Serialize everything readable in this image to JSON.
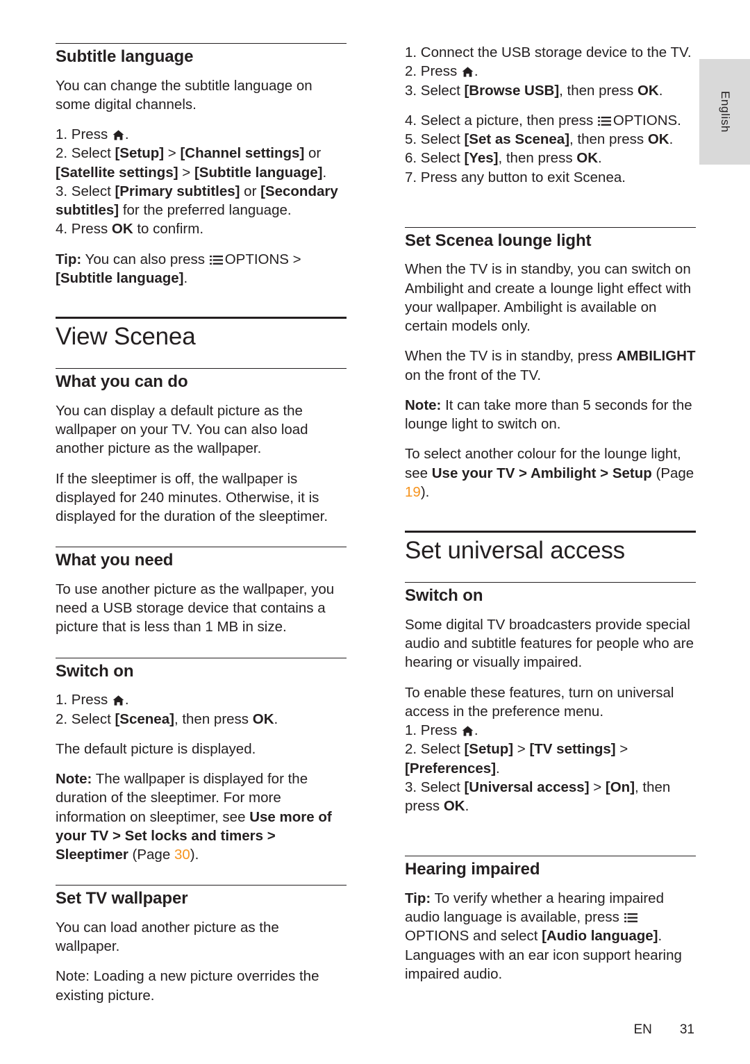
{
  "language_tab": {
    "label": "English"
  },
  "footer": {
    "lang_code": "EN",
    "page_number": "31"
  },
  "colors": {
    "page_reference": "#f7941e",
    "text": "#231f20",
    "tab_background": "#d9d9d9"
  },
  "left_column": {
    "subtitle_language": {
      "heading": "Subtitle language",
      "intro": "You can change the subtitle language on some digital channels.",
      "step1_prefix": "1. Press",
      "step1_suffix": ".",
      "step2_a": "2. Select ",
      "step2_b": "[Setup]",
      "step2_c": " > ",
      "step2_d": "[Channel settings]",
      "step2_e": " or ",
      "step2_f": "[Satellite settings]",
      "step2_g": " > ",
      "step2_h": "[Subtitle language]",
      "step2_i": ".",
      "step3_a": "3. Select ",
      "step3_b": "[Primary subtitles]",
      "step3_c": " or ",
      "step3_d": "[Secondary subtitles]",
      "step3_e": " for the preferred language.",
      "step4_a": "4. Press ",
      "step4_b": "OK",
      "step4_c": " to confirm.",
      "tip_label": "Tip:",
      "tip_a": " You can also press ",
      "tip_options": "OPTIONS",
      "tip_b": " > ",
      "tip_c": "[Subtitle language]",
      "tip_d": "."
    },
    "view_scenea": {
      "heading": "View Scenea"
    },
    "what_you_can_do": {
      "heading": "What you can do",
      "para1": "You can display a default picture as the wallpaper on your TV. You can also load another picture as the wallpaper.",
      "para2": "If the sleeptimer is off, the wallpaper is displayed for 240 minutes. Otherwise, it is displayed for the duration of the sleeptimer."
    },
    "what_you_need": {
      "heading": "What you need",
      "para1": "To use another picture as the wallpaper, you need a USB storage device that contains a picture that is less than 1 MB in size."
    },
    "switch_on": {
      "heading": "Switch on",
      "step1_prefix": "1. Press",
      "step1_suffix": ".",
      "step2_a": "2. Select ",
      "step2_b": "[Scenea]",
      "step2_c": ", then press ",
      "step2_d": "OK",
      "step2_e": ".",
      "result": "The default picture is displayed.",
      "note_label": "Note:",
      "note_a": " The wallpaper is displayed for the duration of the sleeptimer. For more information on sleeptimer, see ",
      "note_bold": "Use more of your TV > Set locks and timers > Sleeptimer",
      "note_b": " (Page ",
      "note_page": "30",
      "note_c": ")."
    },
    "set_tv_wallpaper": {
      "heading": "Set TV wallpaper",
      "para1": "You can load another picture as the wallpaper.",
      "para2": "Note: Loading a new picture overrides the existing picture."
    }
  },
  "right_column": {
    "wallpaper_steps": {
      "step1": "1. Connect the USB storage device to the TV.",
      "step2_prefix": "2. Press",
      "step2_suffix": ".",
      "step3_a": "3. Select ",
      "step3_b": "[Browse USB]",
      "step3_c": ", then press ",
      "step3_d": "OK",
      "step3_e": ".",
      "step4_a": "4. Select a picture, then press ",
      "step4_options": "OPTIONS",
      "step4_b": ".",
      "step5_a": "5. Select ",
      "step5_b": "[Set as Scenea]",
      "step5_c": ", then press ",
      "step5_d": "OK",
      "step5_e": ".",
      "step6_a": "6. Select ",
      "step6_b": "[Yes]",
      "step6_c": ", then press ",
      "step6_d": "OK",
      "step6_e": ".",
      "step7": "7. Press any button to exit Scenea."
    },
    "lounge_light": {
      "heading": "Set Scenea lounge light",
      "para1": "When the TV is in standby, you can switch on Ambilight and create a lounge light effect with your wallpaper. Ambilight is available on certain models only.",
      "para2_a": "When the TV is in standby, press ",
      "para2_bold": "AMBILIGHT",
      "para2_b": " on the front of the TV.",
      "note_label": "Note:",
      "note_a": " It can take more than 5 seconds for the lounge light to switch on.",
      "para3_a": "To select another colour for the lounge light, see ",
      "para3_bold": "Use your TV > Ambilight > Setup",
      "para3_b": " (Page ",
      "para3_page": "19",
      "para3_c": ")."
    },
    "universal_access": {
      "heading": "Set universal access"
    },
    "switch_on": {
      "heading": "Switch on",
      "para1": "Some digital TV broadcasters provide special audio and subtitle features for people who are hearing or visually impaired.",
      "para2": "To enable these features, turn on universal access in the preference menu.",
      "step1_prefix": "1. Press",
      "step1_suffix": ".",
      "step2_a": "2. Select ",
      "step2_b": "[Setup]",
      "step2_c": " > ",
      "step2_d": "[TV settings]",
      "step2_e": " > ",
      "step2_f": "[Preferences]",
      "step2_g": ".",
      "step3_a": "3. Select ",
      "step3_b": "[Universal access]",
      "step3_c": " > ",
      "step3_d": "[On]",
      "step3_e": ", then press ",
      "step3_f": "OK",
      "step3_g": "."
    },
    "hearing_impaired": {
      "heading": "Hearing impaired",
      "tip_label": "Tip:",
      "tip_a": " To verify whether a hearing impaired audio language is available, press ",
      "tip_options": "OPTIONS",
      "tip_b": " and select ",
      "tip_c": "[Audio language]",
      "tip_d": ". Languages with an ear icon support hearing impaired audio."
    }
  }
}
